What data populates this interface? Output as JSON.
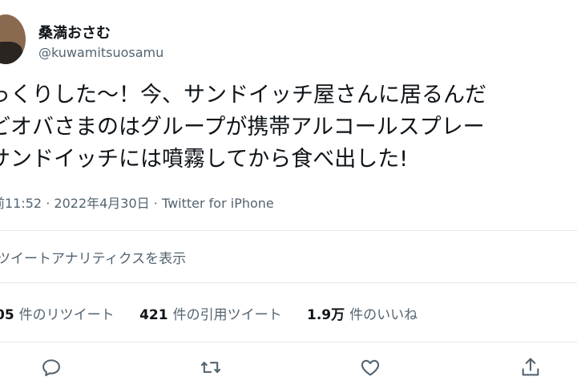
{
  "user": {
    "display_name": "桑満おさむ",
    "handle": "@kuwamitsuosamu"
  },
  "tweet": {
    "lines": [
      "っくりした～！今、サンドイッチ屋さんに居るんだ",
      "どオバさまのはグループが携帯アルコールスプレー",
      "サンドイッチには噴霧してから食べ出した!"
    ]
  },
  "meta": {
    "time": "前11:52",
    "separator1": "·",
    "date": "2022年4月30日",
    "separator2": "·",
    "source": "Twitter for iPhone"
  },
  "analytics": {
    "label": "ツイートアナリティクスを表示"
  },
  "stats": {
    "retweets_count": "05",
    "retweets_label": "件のリツイート",
    "quotes_count": "421",
    "quotes_label": "件の引用ツイート",
    "likes_count": "1.9万",
    "likes_label": "件のいいね"
  },
  "actions": {
    "icons": [
      "reply-icon",
      "retweet-icon",
      "like-icon",
      "share-icon"
    ]
  },
  "colors": {
    "text": "#0f1419",
    "secondary": "#536471",
    "divider": "#e3e8ec"
  }
}
